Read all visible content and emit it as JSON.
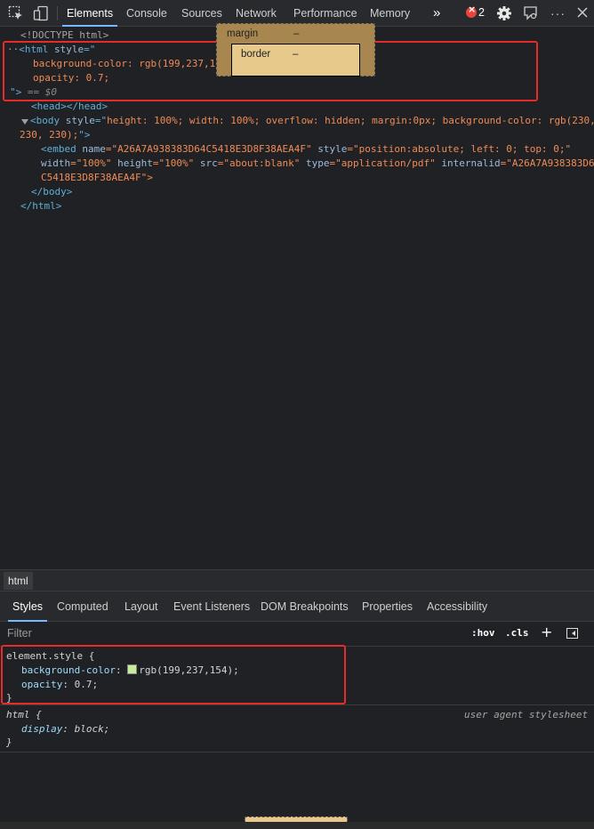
{
  "toolbar": {
    "tabs": [
      "Elements",
      "Console",
      "Sources",
      "Network",
      "Performance",
      "Memory"
    ],
    "more_glyph": "»",
    "error_count": "2",
    "kebab": "···"
  },
  "dom": {
    "doctype": "<!DOCTYPE html>",
    "html_open_prefix": "··",
    "html_open": "<html",
    "html_attr": " style",
    "html_eq": "=\"",
    "html_val1": "background-color: rgb(199,237,154);",
    "html_val2": "opacity: 0.7;",
    "html_close": "\">",
    "selected_marker": " == $0",
    "head": "<head></head>",
    "body_open": "<body",
    "body_attr": " style",
    "body_eq": "=\"",
    "body_val1": "height: 100%; width: 100%; overflow: hidden; margin:0px; background-color: rgb(230,",
    "body_val2": "230, 230);",
    "body_end": "\">",
    "embed_tag": "<embed",
    "embed_name_attr": " name",
    "embed_name_val": "=\"A26A7A938383D64C5418E3D8F38AEA4F\"",
    "embed_style_attr": " style",
    "embed_style_val": "=\"position:absolute; left: 0; top: 0;\"",
    "embed_width_attr": "width",
    "embed_width_val": "=\"100%\"",
    "embed_height_attr": " height",
    "embed_height_val": "=\"100%\"",
    "embed_src_attr": " src",
    "embed_src_val": "=\"about:blank\"",
    "embed_type_attr": " type",
    "embed_type_val": "=\"application/pdf\"",
    "embed_internal_attr": " internalid",
    "embed_internal_val": "=\"A26A7A938383D6",
    "embed_cont": "C5418E3D8F38AEA4F\">",
    "body_close": "</body>",
    "html_close_tag": "</html>"
  },
  "breadcrumb": "html",
  "styles_tabs": [
    "Styles",
    "Computed",
    "Layout",
    "Event Listeners",
    "DOM Breakpoints",
    "Properties",
    "Accessibility"
  ],
  "filter": {
    "placeholder": "Filter",
    "hov": ":hov",
    "cls": ".cls",
    "plus": "+"
  },
  "rules": {
    "element_selector": "element.style {",
    "bg_prop": "background-color",
    "bg_val": "rgb(199,237,154);",
    "bg_swatch": "#c7ed9a",
    "op_prop": "opacity",
    "op_val": "0.7;",
    "close": "}",
    "html_selector": "html {",
    "html_source": "user agent stylesheet",
    "display_prop": "display",
    "display_val": "block;"
  },
  "boxmodel": {
    "margin_label": "margin",
    "margin_val": "–",
    "border_label": "border",
    "border_val": "–"
  }
}
